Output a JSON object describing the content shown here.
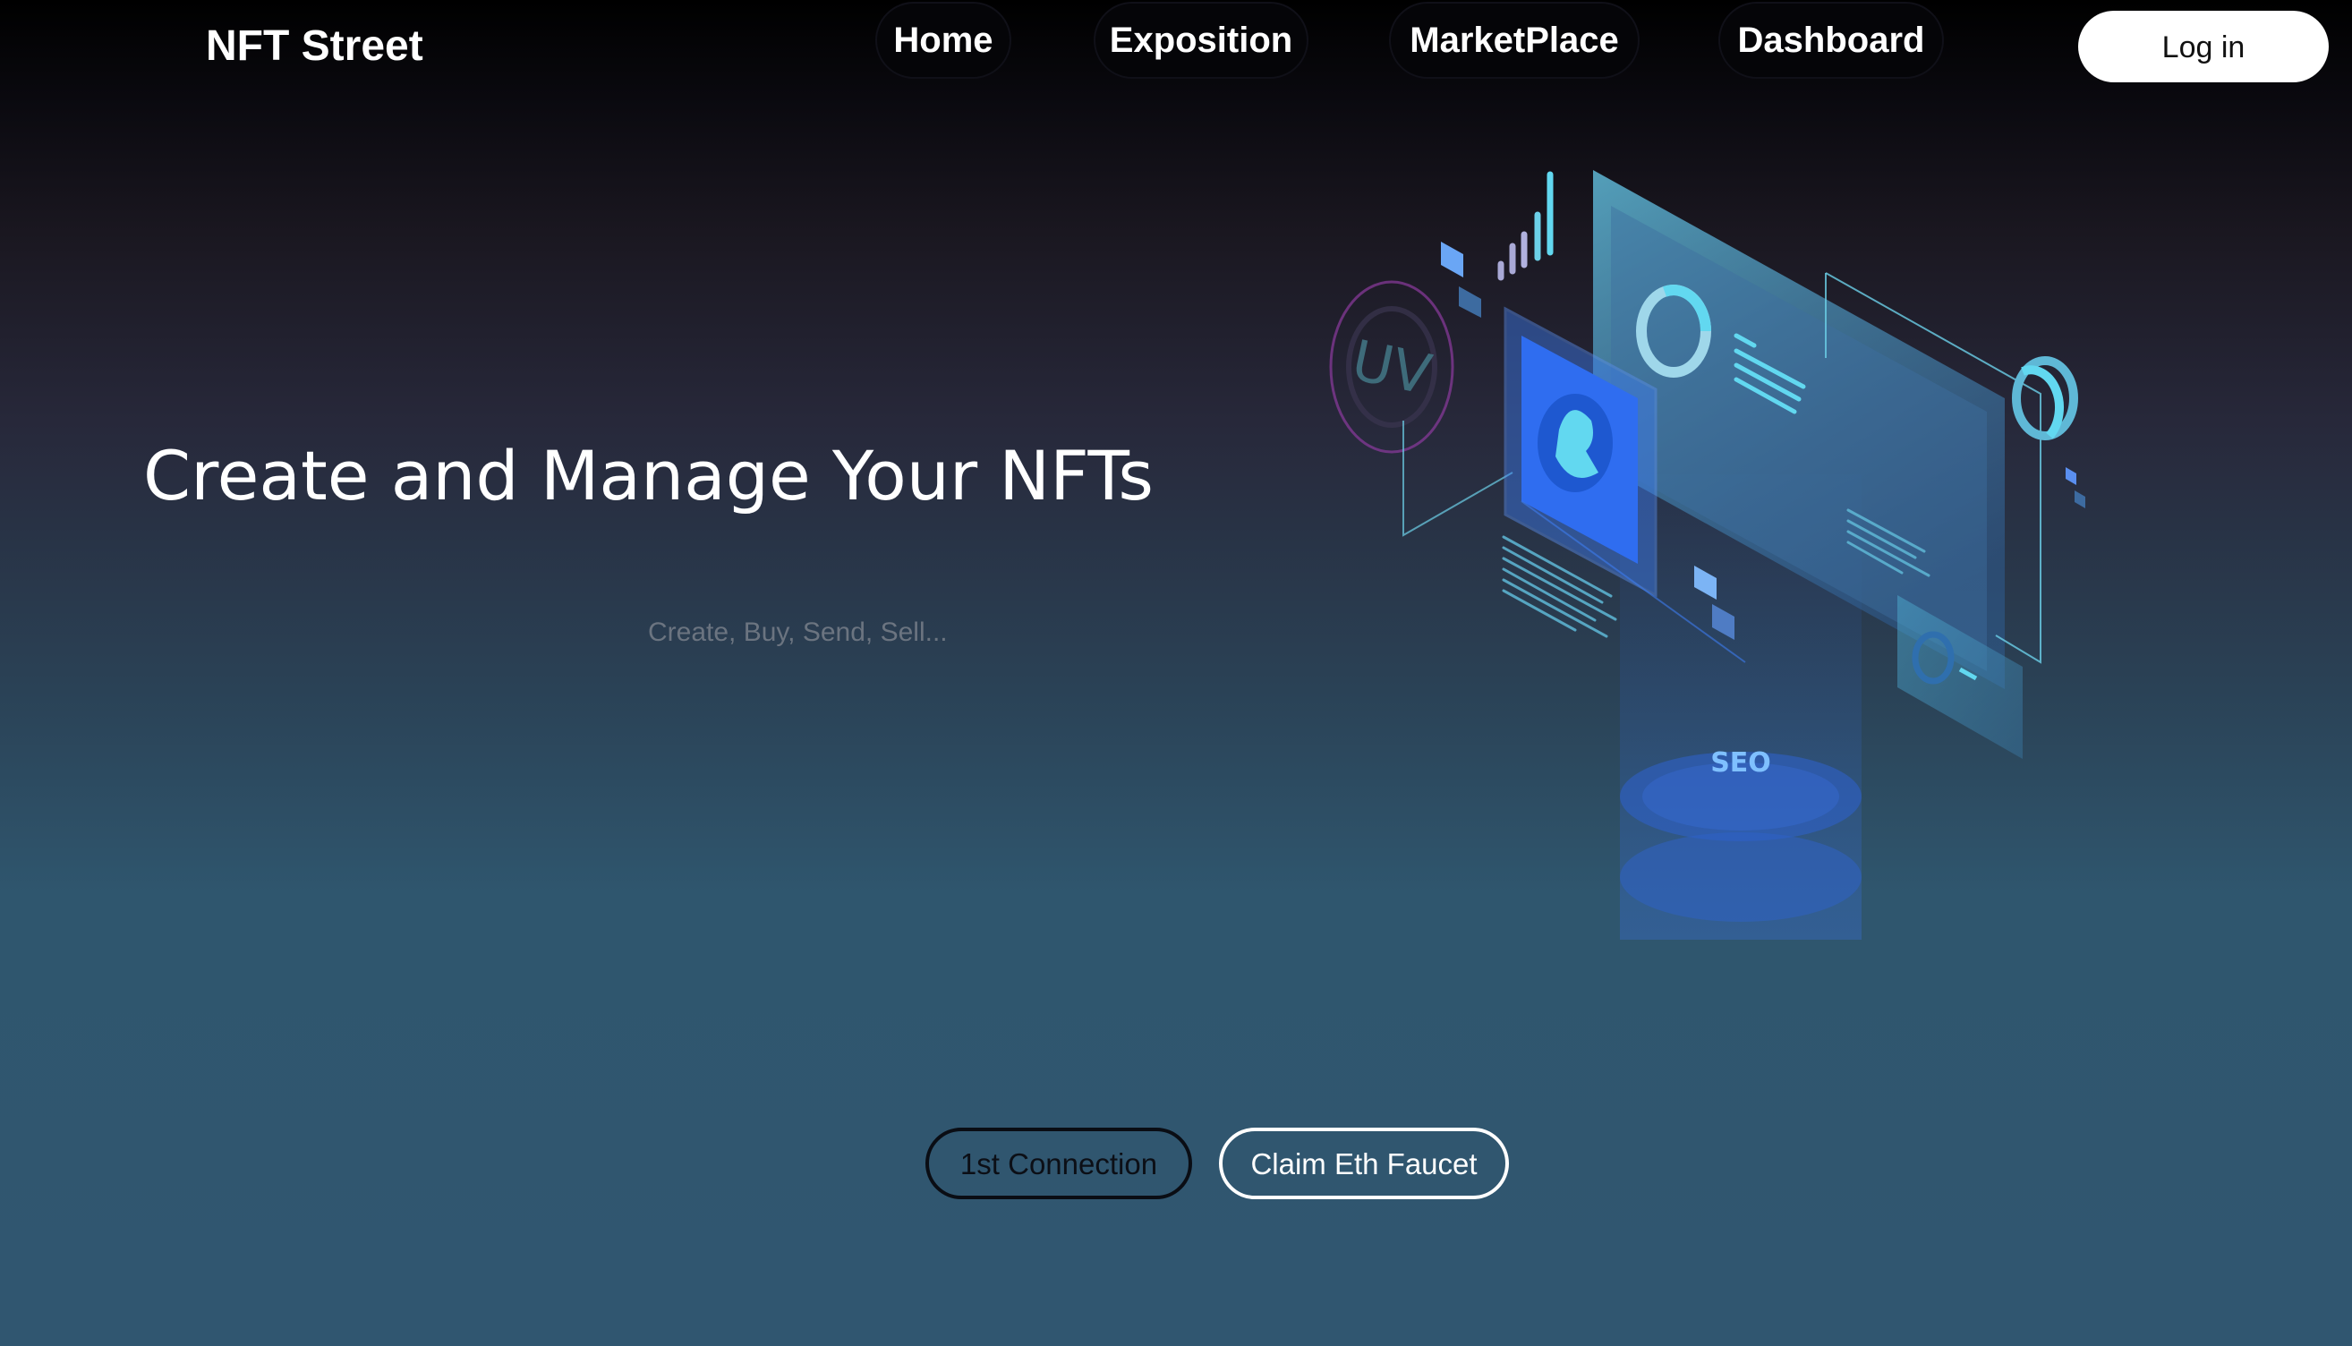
{
  "brand": {
    "name": "NFT Street"
  },
  "nav": {
    "links": [
      {
        "label": "Home"
      },
      {
        "label": "Exposition"
      },
      {
        "label": "MarketPlace"
      },
      {
        "label": "Dashboard"
      }
    ],
    "login_label": "Log in"
  },
  "hero": {
    "title": "Create and Manage Your NFTs",
    "subtitle": "Create, Buy, Send, Sell...",
    "buttons": {
      "first_connection": "1st Connection",
      "claim_faucet": "Claim Eth Faucet"
    },
    "illustration": {
      "name": "isometric-dashboard-illustration",
      "labels": {
        "uv": "UV",
        "seo": "SEO"
      }
    }
  },
  "colors": {
    "accent": "#62d8f0",
    "blue": "#3d7cf0",
    "bg_top": "#000000",
    "bg_bottom": "#305670"
  }
}
